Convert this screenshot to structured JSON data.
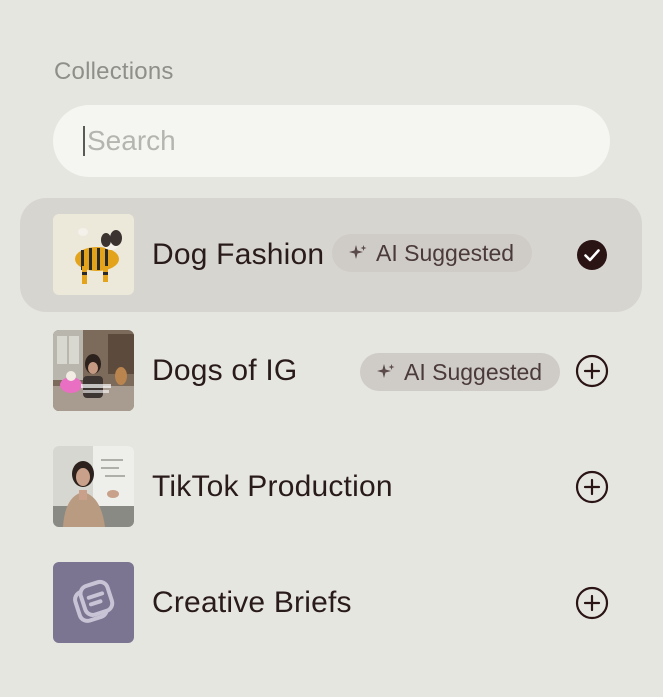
{
  "header": {
    "title": "Collections"
  },
  "search": {
    "placeholder": "Search"
  },
  "collections": [
    {
      "name": "Dog Fashion",
      "badge": "AI Suggested",
      "state": "selected",
      "thumb": "dog-in-striped-sweater"
    },
    {
      "name": "Dogs of IG",
      "badge": "AI Suggested",
      "state": "add",
      "thumb": "woman-with-dogs-on-couch"
    },
    {
      "name": "TikTok Production",
      "badge": "",
      "state": "add",
      "thumb": "woman-talking-to-camera"
    },
    {
      "name": "Creative Briefs",
      "badge": "",
      "state": "add",
      "thumb": "briefs-logo-icon"
    }
  ],
  "colors": {
    "background": "#e6e6e1",
    "selected_row": "#d7d5d0",
    "badge_bg": "#cfcbc6",
    "text_primary": "#2a1b1b",
    "briefs_tile": "#7b7591"
  }
}
